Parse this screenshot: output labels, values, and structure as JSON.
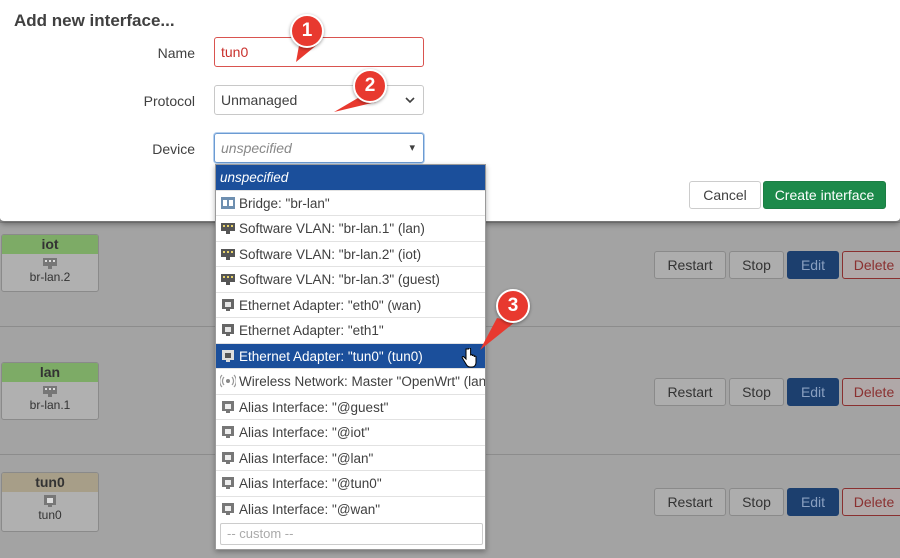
{
  "modal": {
    "title": "Add new interface...",
    "name_label": "Name",
    "name_value": "tun0",
    "protocol_label": "Protocol",
    "protocol_value": "Unmanaged",
    "device_label": "Device",
    "device_placeholder": "unspecified",
    "cancel_label": "Cancel",
    "create_label": "Create interface"
  },
  "dropdown": {
    "items": [
      {
        "label": "unspecified",
        "icon": ""
      },
      {
        "label": "Bridge: \"br-lan\"",
        "icon": "bridge-icon"
      },
      {
        "label": "Software VLAN: \"br-lan.1\" (lan)",
        "icon": "vlan-icon"
      },
      {
        "label": "Software VLAN: \"br-lan.2\" (iot)",
        "icon": "vlan-icon"
      },
      {
        "label": "Software VLAN: \"br-lan.3\" (guest)",
        "icon": "vlan-icon"
      },
      {
        "label": "Ethernet Adapter: \"eth0\" (wan)",
        "icon": "ethernet-icon"
      },
      {
        "label": "Ethernet Adapter: \"eth1\"",
        "icon": "ethernet-icon"
      },
      {
        "label": "Ethernet Adapter: \"tun0\" (tun0)",
        "icon": "ethernet-icon"
      },
      {
        "label": "Wireless Network: Master \"OpenWrt\" (lan)",
        "icon": "wireless-icon"
      },
      {
        "label": "Alias Interface: \"@guest\"",
        "icon": "alias-icon"
      },
      {
        "label": "Alias Interface: \"@iot\"",
        "icon": "alias-icon"
      },
      {
        "label": "Alias Interface: \"@lan\"",
        "icon": "alias-icon"
      },
      {
        "label": "Alias Interface: \"@tun0\"",
        "icon": "alias-icon"
      },
      {
        "label": "Alias Interface: \"@wan\"",
        "icon": "alias-icon"
      }
    ],
    "custom_placeholder": "-- custom --"
  },
  "interfaces": [
    {
      "name": "iot",
      "device": "br-lan.2",
      "color": "#6aa84f"
    },
    {
      "name": "lan",
      "device": "br-lan.1",
      "color": "#6aa84f"
    },
    {
      "name": "tun0",
      "device": "tun0",
      "color": "#9e9580"
    }
  ],
  "row_buttons": {
    "restart": "Restart",
    "stop": "Stop",
    "edit": "Edit",
    "delete": "Delete"
  },
  "callouts": [
    "1",
    "2",
    "3"
  ],
  "colors": {
    "accent": "#1b4f9b",
    "create": "#1c8a4a",
    "callout": "#e8392f",
    "error": "#d9534f"
  }
}
